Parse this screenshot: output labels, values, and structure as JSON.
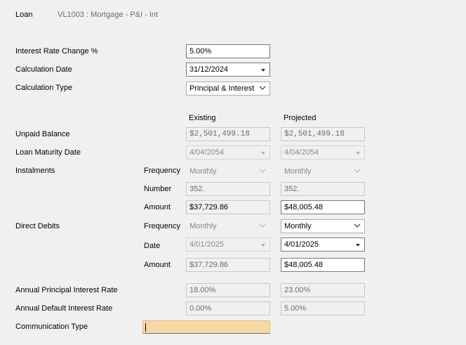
{
  "header": {
    "loan_label": "Loan",
    "loan_value": "VL1003 : Mortgage - P&I - Int"
  },
  "form": {
    "rate_change_label": "Interest Rate Change %",
    "rate_change_value": "5.00%",
    "calc_date_label": "Calculation Date",
    "calc_date_value": "31/12/2024",
    "calc_type_label": "Calculation Type",
    "calc_type_value": "Principal & Interest"
  },
  "columns": {
    "existing": "Existing",
    "projected": "Projected"
  },
  "unpaid_balance": {
    "label": "Unpaid Balance",
    "existing": "$2,501,499.18",
    "projected": "$2,501,499.18"
  },
  "maturity": {
    "label": "Loan Maturity Date",
    "existing": "4/04/2054",
    "projected": "4/04/2054"
  },
  "instalments": {
    "label": "Instalments",
    "frequency_label": "Frequency",
    "frequency_existing": "Monthly",
    "frequency_projected": "Monthly",
    "number_label": "Number",
    "number_existing": "352.",
    "number_projected": "352.",
    "amount_label": "Amount",
    "amount_existing": "$37,729.86",
    "amount_projected": "$48,005.48"
  },
  "direct_debits": {
    "label": "Direct Debits",
    "frequency_label": "Frequency",
    "frequency_existing": "Monthly",
    "frequency_projected": "Monthly",
    "date_label": "Date",
    "date_existing": "4/01/2025",
    "date_projected": "4/01/2025",
    "amount_label": "Amount",
    "amount_existing": "$37,729.86",
    "amount_projected": "$48,005.48"
  },
  "annual_principal": {
    "label": "Annual Principal Interest Rate",
    "existing": "18.00%",
    "projected": "23.00%"
  },
  "annual_default": {
    "label": "Annual Default Interest Rate",
    "existing": "0.00%",
    "projected": "5.00%"
  },
  "communication": {
    "label": "Communication Type",
    "value": ""
  },
  "icons": {
    "dropdown": "dropdown-arrow-icon",
    "chevron": "chevron-down-icon"
  }
}
